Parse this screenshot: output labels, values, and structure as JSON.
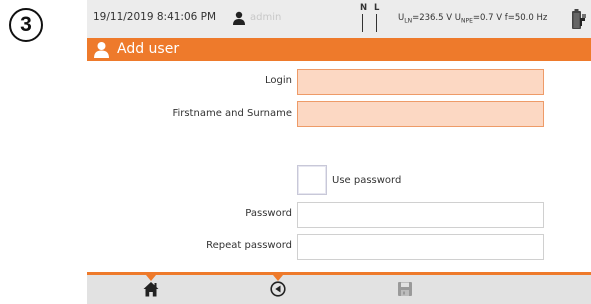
{
  "step": {
    "number": "3"
  },
  "status_bar": {
    "datetime": "19/11/2019 8:41:06 PM",
    "user_icon": "user-icon",
    "username": "admin",
    "n_label": "N",
    "l_label": "L",
    "voltage_pre": "U",
    "ln_sub": "LN",
    "ln_value": "=236.5 V U",
    "npe_sub": "NPE",
    "npe_value": "=0.7 V f=50.0 Hz",
    "battery_icon": "battery-icon"
  },
  "header": {
    "icon": "user-icon",
    "title": "Add user"
  },
  "form": {
    "login_label": "Login",
    "login_value": "",
    "name_label": "Firstname and Surname",
    "name_value": "",
    "use_password_label": "Use password",
    "use_password_checked": false,
    "password_label": "Password",
    "password_value": "",
    "repeat_password_label": "Repeat password",
    "repeat_password_value": ""
  },
  "toolbar": {
    "home_icon": "home-icon",
    "back_icon": "back-icon",
    "save_icon": "save-icon",
    "save_enabled": false
  },
  "colors": {
    "accent": "#ee7a2b",
    "field_highlight": "#fcd8c3",
    "status_bg": "#ececec",
    "toolbar_bg": "#e2e2e2"
  }
}
